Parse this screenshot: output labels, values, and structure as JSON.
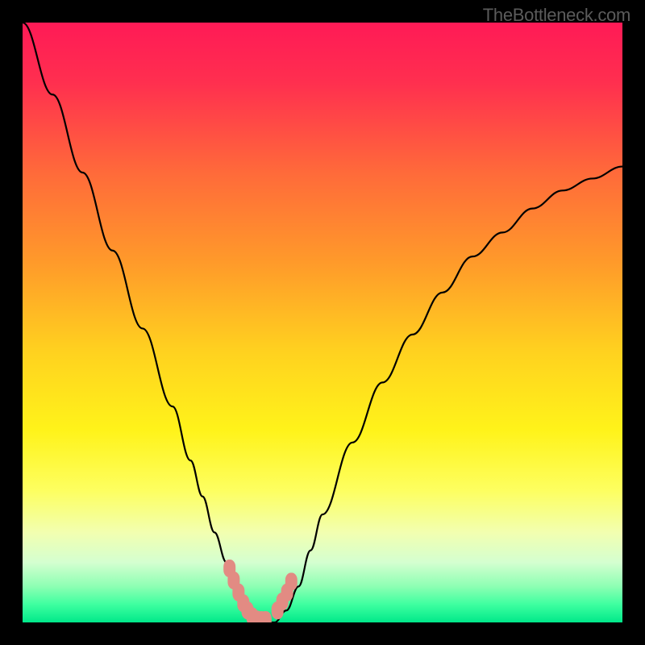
{
  "watermark": "TheBottleneck.com",
  "chart_data": {
    "type": "line",
    "title": "",
    "xlabel": "",
    "ylabel": "",
    "xlim": [
      0,
      100
    ],
    "ylim": [
      0,
      100
    ],
    "series": [
      {
        "name": "bottleneck-curve",
        "x": [
          0,
          5,
          10,
          15,
          20,
          25,
          28,
          30,
          32,
          34,
          36,
          37,
          38,
          39,
          40,
          42,
          44,
          46,
          48,
          50,
          55,
          60,
          65,
          70,
          75,
          80,
          85,
          90,
          95,
          100
        ],
        "y": [
          100,
          88,
          75,
          62,
          49,
          36,
          27,
          21,
          15,
          10,
          5,
          3,
          1,
          0,
          0,
          0,
          2,
          6,
          12,
          18,
          30,
          40,
          48,
          55,
          61,
          65,
          69,
          72,
          74,
          76
        ]
      }
    ],
    "markers": {
      "name": "highlighted-points",
      "x": [
        34.5,
        35.2,
        36.0,
        36.8,
        37.5,
        38.3,
        39.0,
        39.8,
        40.5,
        42.5,
        43.3,
        44.1,
        44.8
      ],
      "y": [
        9.0,
        7.0,
        5.0,
        3.2,
        2.0,
        1.0,
        0.5,
        0.4,
        0.4,
        2.0,
        3.5,
        5.0,
        6.8
      ]
    },
    "gradient_stops": [
      {
        "offset": 0.0,
        "color": "#ff1a56"
      },
      {
        "offset": 0.1,
        "color": "#ff2f4f"
      },
      {
        "offset": 0.25,
        "color": "#ff6a3a"
      },
      {
        "offset": 0.4,
        "color": "#ff9a2a"
      },
      {
        "offset": 0.55,
        "color": "#ffd21f"
      },
      {
        "offset": 0.68,
        "color": "#fff31a"
      },
      {
        "offset": 0.78,
        "color": "#fdff60"
      },
      {
        "offset": 0.85,
        "color": "#f2ffb0"
      },
      {
        "offset": 0.9,
        "color": "#d4ffd0"
      },
      {
        "offset": 0.94,
        "color": "#8dffb3"
      },
      {
        "offset": 0.97,
        "color": "#3effa0"
      },
      {
        "offset": 1.0,
        "color": "#00e88a"
      }
    ]
  }
}
